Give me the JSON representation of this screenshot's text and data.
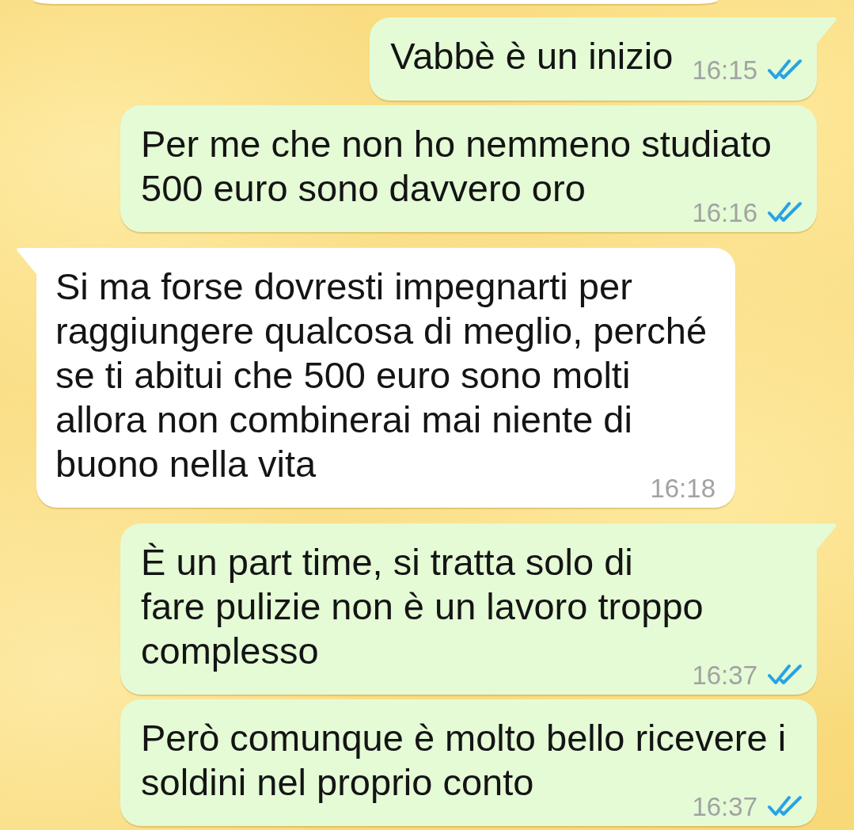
{
  "partial_bubble_above": {
    "kind": "incoming"
  },
  "messages": [
    {
      "kind": "outgoing",
      "tail": true,
      "text": "Vabbè è un inizio",
      "time": "16:15",
      "read": true
    },
    {
      "kind": "outgoing",
      "tail": false,
      "text": "Per me che non ho nemmeno studiato 500 euro sono davvero oro",
      "time": "16:16",
      "read": true
    },
    {
      "kind": "incoming",
      "tail": true,
      "text": "Si ma forse dovresti impegnarti per raggiungere qualcosa di meglio, perché se ti abitui che 500 euro sono molti allora non combinerai mai niente di buono nella vita",
      "time": "16:18"
    },
    {
      "kind": "outgoing",
      "tail": true,
      "text": "È un part time, si tratta solo di\nfare pulizie non è un lavoro troppo complesso",
      "time": "16:37",
      "read": true
    },
    {
      "kind": "outgoing",
      "tail": false,
      "text": "Però comunque è molto bello ricevere i soldini nel proprio conto",
      "time": "16:37",
      "read": true
    }
  ]
}
